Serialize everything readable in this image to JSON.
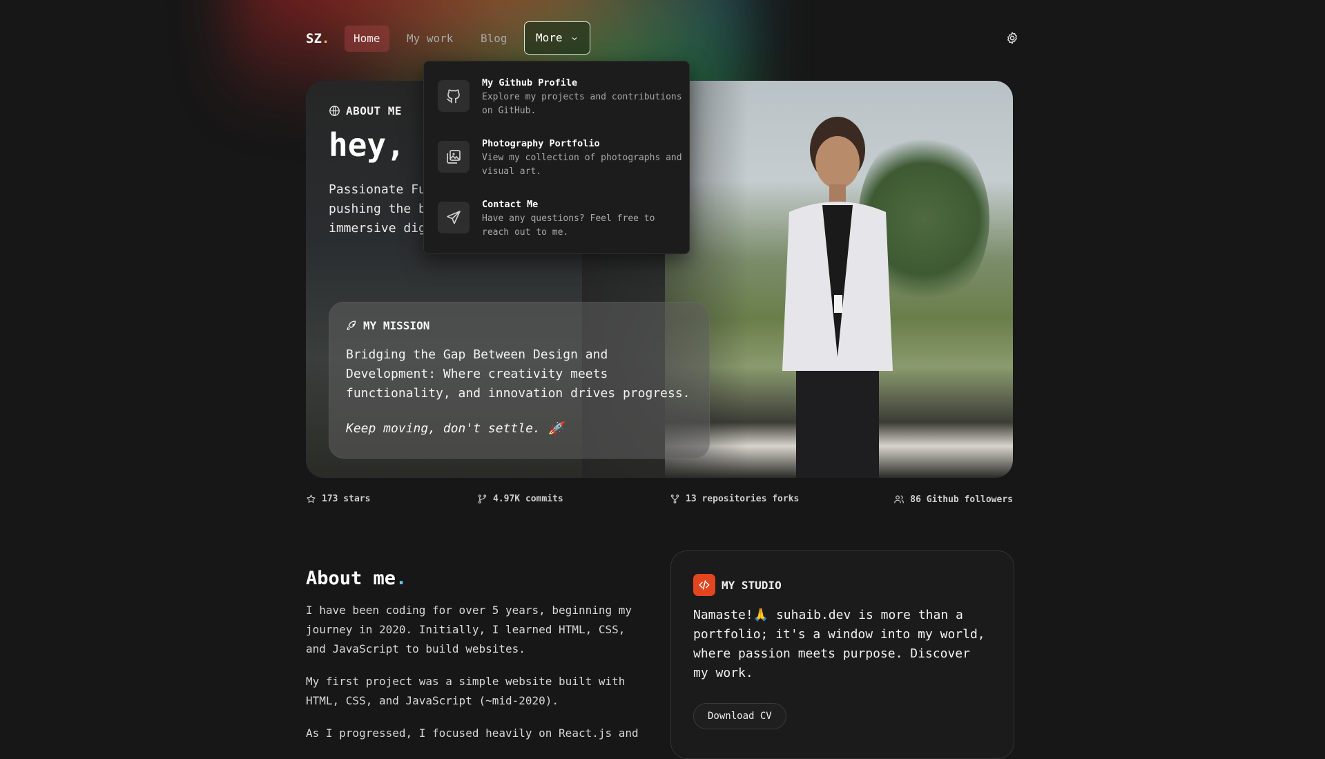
{
  "nav": {
    "logo": "SZ",
    "logo_dot": ".",
    "home": "Home",
    "my_work": "My work",
    "blog": "Blog",
    "more": "More"
  },
  "dropdown": {
    "items": [
      {
        "title": "My Github Profile",
        "desc": "Explore my projects and contributions on GitHub.",
        "icon": "github-icon"
      },
      {
        "title": "Photography Portfolio",
        "desc": "View my collection of photographs and visual art.",
        "icon": "image-icon"
      },
      {
        "title": "Contact Me",
        "desc": "Have any questions? Feel free to reach out to me.",
        "icon": "send-icon"
      }
    ]
  },
  "hero": {
    "about_tag": "ABOUT ME",
    "greeting": "hey,",
    "intro": "Passionate Fu                                              e,\npushing the b                                               te\nimmersive dig",
    "mission_tag": "MY MISSION",
    "mission_text": "Bridging the Gap Between Design and Development: Where creativity meets functionality, and innovation drives progress.",
    "mission_quote": "Keep moving, don't settle. 🚀"
  },
  "stats": {
    "stars": "173 stars",
    "commits": "4.97K commits",
    "forks": "13 repositories forks",
    "followers": "86 Github followers"
  },
  "about": {
    "heading": "About me",
    "heading_dot": ".",
    "p1": "I have been coding for over 5 years, beginning my journey in 2020. Initially, I learned HTML, CSS, and JavaScript to build websites.",
    "p2": "My first project was a simple website built with HTML, CSS, and JavaScript (~mid-2020).",
    "p3": "As I progressed, I focused heavily on React.js and"
  },
  "studio": {
    "tag": "MY STUDIO",
    "text": "Namaste!🙏 suhaib.dev is more than a portfolio; it's a window into my world, where passion meets purpose. Discover my work.",
    "cv_button": "Download CV"
  },
  "colors": {
    "accent_orange": "#e2451f",
    "home_bg": "#8a3c3c",
    "more_border": "#d8ecd6"
  }
}
